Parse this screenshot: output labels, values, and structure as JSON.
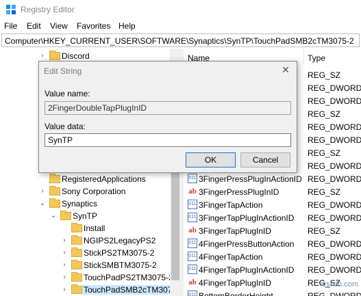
{
  "window": {
    "title": "Registry Editor"
  },
  "menu": [
    "File",
    "Edit",
    "View",
    "Favorites",
    "Help"
  ],
  "address": "Computer\\HKEY_CURRENT_USER\\SOFTWARE\\Synaptics\\SynTP\\TouchPadSMB2cTM3075-2",
  "tree": [
    {
      "label": "Discord",
      "expander": "chevron-right"
    },
    {
      "label": "RegisteredApplications",
      "expander": ""
    },
    {
      "label": "Sony Corporation",
      "expander": "chevron-right"
    },
    {
      "label": "Synaptics",
      "expander": "chevron-down"
    },
    {
      "label": "SynTP",
      "expander": "chevron-down"
    },
    {
      "label": "Install",
      "expander": ""
    },
    {
      "label": "NGIPS2LegacyPS2",
      "expander": "chevron-right"
    },
    {
      "label": "StickPS2TM3075-2",
      "expander": "chevron-right"
    },
    {
      "label": "StickSMBTM3075-2",
      "expander": "chevron-right"
    },
    {
      "label": "TouchPadPS2TM3075-2",
      "expander": "chevron-right"
    },
    {
      "label": "TouchPadSMB2cTM3075-2",
      "expander": "chevron-right"
    }
  ],
  "list": {
    "headers": {
      "name": "Name",
      "type": "Type"
    },
    "rows": [
      {
        "name": "",
        "type": "REG_SZ",
        "icon": "sz"
      },
      {
        "name": "",
        "type": "REG_DWORD",
        "icon": "dw"
      },
      {
        "name": "",
        "type": "REG_DWORD",
        "icon": "dw"
      },
      {
        "name": "",
        "type": "REG_SZ",
        "icon": "sz"
      },
      {
        "name": "",
        "type": "REG_DWORD",
        "icon": "dw"
      },
      {
        "name": "",
        "type": "REG_DWORD",
        "icon": "dw"
      },
      {
        "name": "",
        "type": "REG_SZ",
        "icon": "sz"
      },
      {
        "name": "",
        "type": "REG_DWORD",
        "icon": "dw"
      },
      {
        "name": "3FingerPressPlugInActionID",
        "type": "REG_DWORD",
        "icon": "dw"
      },
      {
        "name": "3FingerPressPlugInID",
        "type": "REG_SZ",
        "icon": "sz"
      },
      {
        "name": "3FingerTapAction",
        "type": "REG_DWORD",
        "icon": "dw"
      },
      {
        "name": "3FingerTapPlugInActionID",
        "type": "REG_DWORD",
        "icon": "dw"
      },
      {
        "name": "3FingerTapPlugInID",
        "type": "REG_SZ",
        "icon": "sz"
      },
      {
        "name": "4FingerPressButtonAction",
        "type": "REG_DWORD",
        "icon": "dw"
      },
      {
        "name": "4FingerTapAction",
        "type": "REG_DWORD",
        "icon": "dw"
      },
      {
        "name": "4FingerTapPlugInActionID",
        "type": "REG_DWORD",
        "icon": "dw"
      },
      {
        "name": "4FingerTapPlugInID",
        "type": "REG_SZ",
        "icon": "sz"
      },
      {
        "name": "BottomBorderHeight",
        "type": "REG_DWORD",
        "icon": "dw"
      }
    ]
  },
  "dialog": {
    "title": "Edit String",
    "value_name_label": "Value name:",
    "value_name": "2FingerDoubleTapPlugInID",
    "value_data_label": "Value data:",
    "value_data": "SynTP",
    "ok": "OK",
    "cancel": "Cancel",
    "close_glyph": "✕"
  },
  "watermark": "wsxdn.com"
}
